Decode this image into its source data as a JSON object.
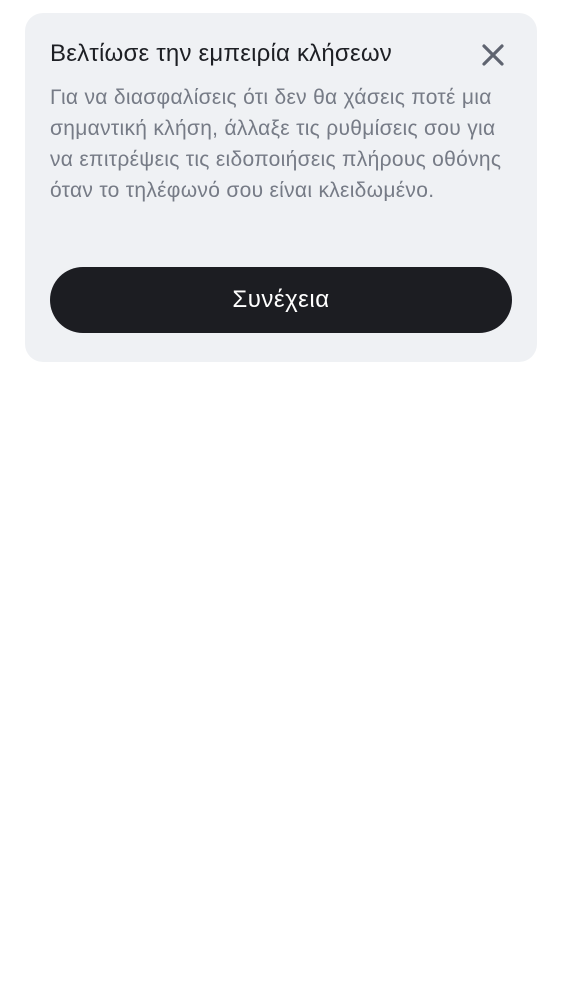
{
  "dialog": {
    "title": "Βελτίωσε την εμπειρία κλήσεων",
    "message": "Για να διασφαλίσεις ότι δεν θα χάσεις ποτέ μια σημαντική κλήση, άλλαξε τις ρυθμίσεις σου για να επιτρέψεις τις ειδοποιήσεις πλήρους οθόνης όταν το τηλέφωνό σου είναι κλειδωμένο.",
    "close_icon": "close-icon",
    "continue_label": "Συνέχεια"
  },
  "colors": {
    "card_background": "#eff1f4",
    "title": "#1d1f24",
    "message": "#767b86",
    "button_background": "#1c1d22",
    "button_text": "#ffffff",
    "close_icon": "#5f6470"
  }
}
